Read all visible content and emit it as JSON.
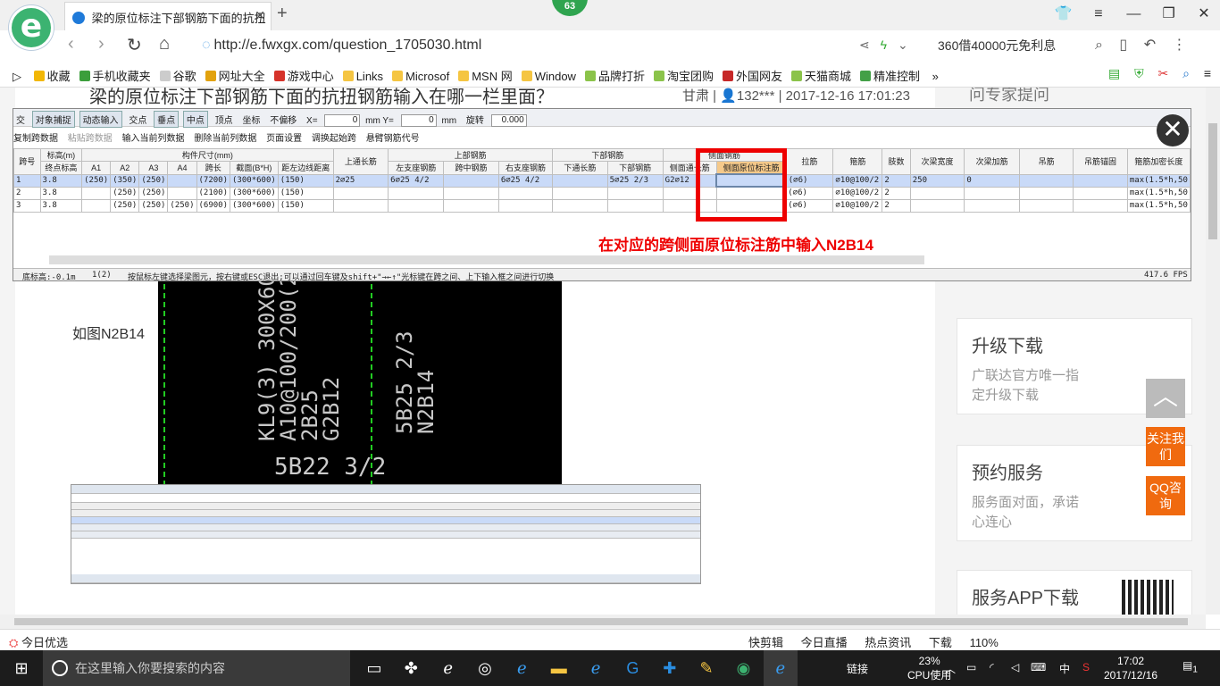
{
  "browser": {
    "logo_glyph": "e",
    "tab_title": "梁的原位标注下部钢筋下面的抗扭",
    "tab_close": "✕",
    "new_tab": "+",
    "badge": "63",
    "url": "http://e.fwxgx.com/question_1705030.html",
    "ad_text": "360借40000元免利息",
    "bookmarks": [
      {
        "label": "收藏",
        "color": "#f2b705"
      },
      {
        "label": "手机收藏夹",
        "color": "#3b9e3b"
      },
      {
        "label": "谷歌",
        "color": "#cccccc"
      },
      {
        "label": "网址大全",
        "color": "#e2a20d"
      },
      {
        "label": "游戏中心",
        "color": "#d6332a"
      },
      {
        "label": "Links",
        "color": "#f5c542"
      },
      {
        "label": "Microsof",
        "color": "#f5c542"
      },
      {
        "label": "MSN 网",
        "color": "#f5c542"
      },
      {
        "label": "Window",
        "color": "#f5c542"
      },
      {
        "label": "品牌打折",
        "color": "#8bc34a"
      },
      {
        "label": "淘宝团购",
        "color": "#8bc34a"
      },
      {
        "label": "外国网友",
        "color": "#c62828"
      },
      {
        "label": "天猫商城",
        "color": "#8bc34a"
      },
      {
        "label": "精准控制",
        "color": "#43a047"
      }
    ],
    "bookmarks_more": "»",
    "status_left": "今日优选",
    "status_right": [
      "快剪辑",
      "今日直播",
      "热点资讯",
      "下载",
      "110%"
    ]
  },
  "page": {
    "title": "梁的原位标注下部钢筋下面的抗扭钢筋输入在哪一栏里面？",
    "meta": "甘肃 | 👤132*** | 2017-12-16 17:01:23",
    "answer": "如图N2B14",
    "sidebar_top": "问专家提问",
    "side_boxes": [
      {
        "title": "升级下载",
        "sub": "广联达官方唯一指定升级下载"
      },
      {
        "title": "预约服务",
        "sub": "服务面对面，承诺心连心"
      },
      {
        "title": "服务APP下载",
        "sub": ""
      }
    ],
    "float_follow": "关注我们",
    "float_qq": "QQ咨询",
    "totop": "︿",
    "cad_texts": [
      "KL9(3) 300X600",
      "A10@100/200(2)",
      "2B25",
      "G2B12",
      "5B25 2/3",
      "N2B14",
      "5B22 3/2"
    ]
  },
  "app": {
    "toolbar1": [
      "交",
      "对象捕捉",
      "动态输入",
      "交点",
      "垂点",
      "中点",
      "顶点",
      "坐标",
      "不偏移"
    ],
    "x_label": "X=",
    "x_value": "0",
    "y_label": "mm Y=",
    "y_value": "0",
    "mm": "mm",
    "rotate_label": "旋转",
    "rotate_value": "0.000",
    "toolbar2": [
      {
        "label": "复制跨数据",
        "disabled": false
      },
      {
        "label": "粘贴跨数据",
        "disabled": true
      },
      {
        "label": "输入当前列数据",
        "disabled": false
      },
      {
        "label": "删除当前列数据",
        "disabled": false
      },
      {
        "label": "页面设置",
        "disabled": false
      },
      {
        "label": "调换起始跨",
        "disabled": false
      },
      {
        "label": "悬臂钢筋代号",
        "disabled": false
      }
    ],
    "headers": {
      "span": "跨号",
      "elev": "标高(m)",
      "end_elev": "终点标高",
      "dims": "构件尺寸(mm)",
      "a1": "A1",
      "a2": "A2",
      "a3": "A3",
      "a4": "A4",
      "span_len": "跨长",
      "section": "截面(B*H)",
      "edge_dist": "距左边线距离",
      "top_through": "上通长筋",
      "top_rebar": "上部钢筋",
      "left_support": "左支座钢筋",
      "mid_span": "跨中钢筋",
      "right_support": "右支座钢筋",
      "bottom_rebar": "下部钢筋",
      "bottom_through": "下通长筋",
      "bottom_bar": "下部钢筋",
      "side_rebar": "侧面钢筋",
      "side_through": "侧面通长筋",
      "side_inplace": "侧面原位标注筋",
      "tie": "拉筋",
      "stirrup": "箍筋",
      "legs": "肢数",
      "secondary_width": "次梁宽度",
      "secondary_add": "次梁加筋",
      "hanger": "吊筋",
      "hanger_anchor": "吊筋锚固",
      "dense_len": "箍筋加密长度"
    },
    "rows": [
      {
        "span": "1",
        "elev": "3.8",
        "a1": "(250)",
        "a2": "(350)",
        "a3": "(250)",
        "a4": "",
        "len": "(7200)",
        "sec": "(300*600)",
        "edge": "(150)",
        "top_thru": "2⌀25",
        "left": "6⌀25 4/2",
        "mid": "",
        "right": "6⌀25 4/2",
        "bot_thru": "",
        "bot": "5⌀25 2/3",
        "side_thru": "G2⌀12",
        "side_inplace": "",
        "tie": "(⌀6)",
        "stirrup": "⌀10@100/2",
        "legs": "2",
        "sec_w": "250",
        "sec_add": "0",
        "hanger": "",
        "anchor": "",
        "dense": "max(1.5*h,50"
      },
      {
        "span": "2",
        "elev": "3.8",
        "a1": "",
        "a2": "(250)",
        "a3": "(250)",
        "a4": "",
        "len": "(2100)",
        "sec": "(300*600)",
        "edge": "(150)",
        "top_thru": "",
        "left": "",
        "mid": "",
        "right": "",
        "bot_thru": "",
        "bot": "",
        "side_thru": "",
        "side_inplace": "",
        "tie": "(⌀6)",
        "stirrup": "⌀10@100/2",
        "legs": "2",
        "sec_w": "",
        "sec_add": "",
        "hanger": "",
        "anchor": "",
        "dense": "max(1.5*h,50"
      },
      {
        "span": "3",
        "elev": "3.8",
        "a1": "",
        "a2": "(250)",
        "a3": "(250)",
        "a4": "(250)",
        "len": "(6900)",
        "sec": "(300*600)",
        "edge": "(150)",
        "top_thru": "",
        "left": "",
        "mid": "",
        "right": "",
        "bot_thru": "",
        "bot": "",
        "side_thru": "",
        "side_inplace": "",
        "tie": "(⌀6)",
        "stirrup": "⌀10@100/2",
        "legs": "2",
        "sec_w": "",
        "sec_add": "",
        "hanger": "",
        "anchor": "",
        "dense": "max(1.5*h,50"
      }
    ],
    "annotation": "在对应的跨侧面原位标注筋中输入N2B14",
    "status": {
      "elev": "底标高:-0.1m",
      "span": "1(2)",
      "hint": "按鼠标左键选择梁图元，按右键或ESC退出;可以通过回车键及shift+\"→←↑\"光标键在跨之间、上下输入框之间进行切换",
      "fps": "417.6 FPS"
    },
    "close": "✕"
  },
  "taskbar": {
    "search_placeholder": "在这里输入你要搜索的内容",
    "link": "链接",
    "cpu_pct": "23%",
    "cpu_label": "CPU使用",
    "ime": "中",
    "time": "17:02",
    "date": "2017/12/16",
    "notify": "1"
  }
}
